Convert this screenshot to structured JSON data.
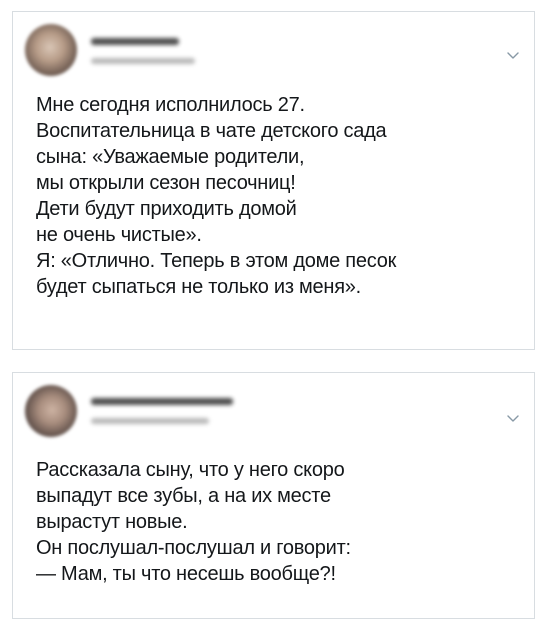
{
  "tweets": [
    {
      "lines": [
        "Мне сегодня исполнилось 27.",
        "Воспитательница в чате детского сада",
        "сына: «Уважаемые родители,",
        "мы открыли сезон песочниц!",
        "Дети будут приходить домой",
        "не очень чистые».",
        "Я: «Отлично. Теперь в этом доме песок",
        "будет сыпаться не только из меня»."
      ]
    },
    {
      "lines": [
        "Рассказала сыну, что у него скоро",
        "выпадут все зубы, а на их месте",
        "вырастут новые.",
        "Он послушал-послушал и говорит:",
        "— Мам, ты что несешь вообще?!"
      ]
    }
  ],
  "icons": {
    "avatar": "avatar-blurred",
    "menu": "chevron-down-icon"
  },
  "colors": {
    "text": "#14171a",
    "border": "#d8dde1",
    "chevron": "#8899a6"
  }
}
